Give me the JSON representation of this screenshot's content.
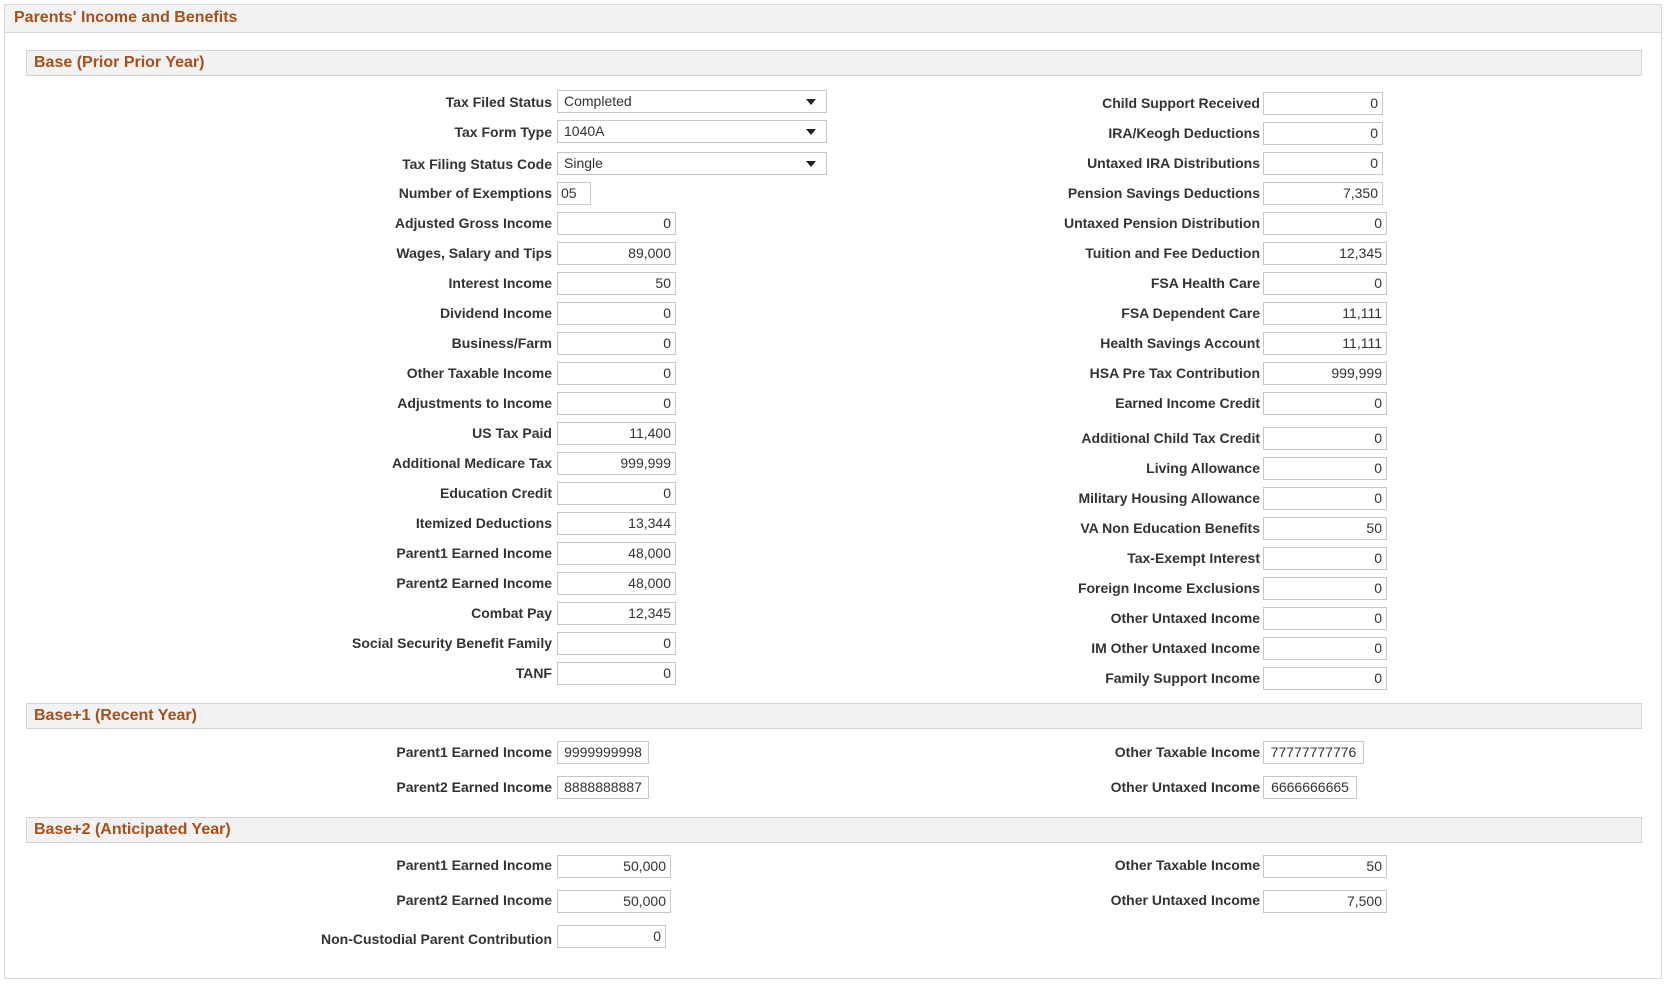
{
  "page_title": "Parents' Income and Benefits",
  "sections": {
    "base": "Base (Prior Prior Year)",
    "base1": "Base+1 (Recent Year)",
    "base2": "Base+2 (Anticipated Year)"
  },
  "base_left": {
    "tax_filed_status": {
      "label": "Tax Filed Status",
      "value": "Completed"
    },
    "tax_form_type": {
      "label": "Tax Form Type",
      "value": "1040A"
    },
    "tax_filing_status_code": {
      "label": "Tax Filing Status Code",
      "value": "Single"
    },
    "number_of_exemptions": {
      "label": "Number of Exemptions",
      "value": "05"
    },
    "adjusted_gross_income": {
      "label": "Adjusted Gross Income",
      "value": "0"
    },
    "wages": {
      "label": "Wages, Salary and Tips",
      "value": "89,000"
    },
    "interest_income": {
      "label": "Interest Income",
      "value": "50"
    },
    "dividend_income": {
      "label": "Dividend Income",
      "value": "0"
    },
    "business_farm": {
      "label": "Business/Farm",
      "value": "0"
    },
    "other_taxable_income": {
      "label": "Other Taxable Income",
      "value": "0"
    },
    "adjustments_to_income": {
      "label": "Adjustments to Income",
      "value": "0"
    },
    "us_tax_paid": {
      "label": "US Tax Paid",
      "value": "11,400"
    },
    "additional_medicare_tax": {
      "label": "Additional Medicare Tax",
      "value": "999,999"
    },
    "education_credit": {
      "label": "Education Credit",
      "value": "0"
    },
    "itemized_deductions": {
      "label": "Itemized Deductions",
      "value": "13,344"
    },
    "parent1_earned_income": {
      "label": "Parent1 Earned Income",
      "value": "48,000"
    },
    "parent2_earned_income": {
      "label": "Parent2 Earned Income",
      "value": "48,000"
    },
    "combat_pay": {
      "label": "Combat Pay",
      "value": "12,345"
    },
    "social_security_benefit_family": {
      "label": "Social Security Benefit Family",
      "value": "0"
    },
    "tanf": {
      "label": "TANF",
      "value": "0"
    }
  },
  "base_right": {
    "child_support_received": {
      "label": "Child Support Received",
      "value": "0"
    },
    "ira_keogh_deductions": {
      "label": "IRA/Keogh Deductions",
      "value": "0"
    },
    "untaxed_ira_distributions": {
      "label": "Untaxed IRA Distributions",
      "value": "0"
    },
    "pension_savings_deductions": {
      "label": "Pension Savings Deductions",
      "value": "7,350"
    },
    "untaxed_pension_distribution": {
      "label": "Untaxed Pension Distribution",
      "value": "0"
    },
    "tuition_fee_deduction": {
      "label": "Tuition and Fee Deduction",
      "value": "12,345"
    },
    "fsa_health_care": {
      "label": "FSA Health Care",
      "value": "0"
    },
    "fsa_dependent_care": {
      "label": "FSA Dependent Care",
      "value": "11,111"
    },
    "health_savings_account": {
      "label": "Health Savings Account",
      "value": "11,111"
    },
    "hsa_pre_tax_contribution": {
      "label": "HSA Pre Tax Contribution",
      "value": "999,999"
    },
    "earned_income_credit": {
      "label": "Earned Income Credit",
      "value": "0"
    },
    "additional_child_tax_credit": {
      "label": "Additional Child Tax Credit",
      "value": "0"
    },
    "living_allowance": {
      "label": "Living Allowance",
      "value": "0"
    },
    "military_housing_allowance": {
      "label": "Military Housing Allowance",
      "value": "0"
    },
    "va_non_education_benefits": {
      "label": "VA Non Education Benefits",
      "value": "50"
    },
    "tax_exempt_interest": {
      "label": "Tax-Exempt Interest",
      "value": "0"
    },
    "foreign_income_exclusions": {
      "label": "Foreign Income Exclusions",
      "value": "0"
    },
    "other_untaxed_income": {
      "label": "Other Untaxed Income",
      "value": "0"
    },
    "im_other_untaxed_income": {
      "label": "IM Other Untaxed Income",
      "value": "0"
    },
    "family_support_income": {
      "label": "Family Support Income",
      "value": "0"
    }
  },
  "base1": {
    "parent1_earned_income": {
      "label": "Parent1 Earned Income",
      "value": "9999999998"
    },
    "parent2_earned_income": {
      "label": "Parent2 Earned Income",
      "value": "8888888887"
    },
    "other_taxable_income": {
      "label": "Other Taxable Income",
      "value": "77777777776"
    },
    "other_untaxed_income": {
      "label": "Other Untaxed Income",
      "value": "6666666665"
    }
  },
  "base2": {
    "parent1_earned_income": {
      "label": "Parent1 Earned Income",
      "value": "50,000"
    },
    "parent2_earned_income": {
      "label": "Parent2 Earned Income",
      "value": "50,000"
    },
    "non_custodial_parent_contribution": {
      "label": "Non-Custodial Parent Contribution",
      "value": "0"
    },
    "other_taxable_income": {
      "label": "Other Taxable Income",
      "value": "50"
    },
    "other_untaxed_income": {
      "label": "Other Untaxed Income",
      "value": "7,500"
    }
  },
  "icons": {
    "dropdown": "chevron-down-icon"
  }
}
